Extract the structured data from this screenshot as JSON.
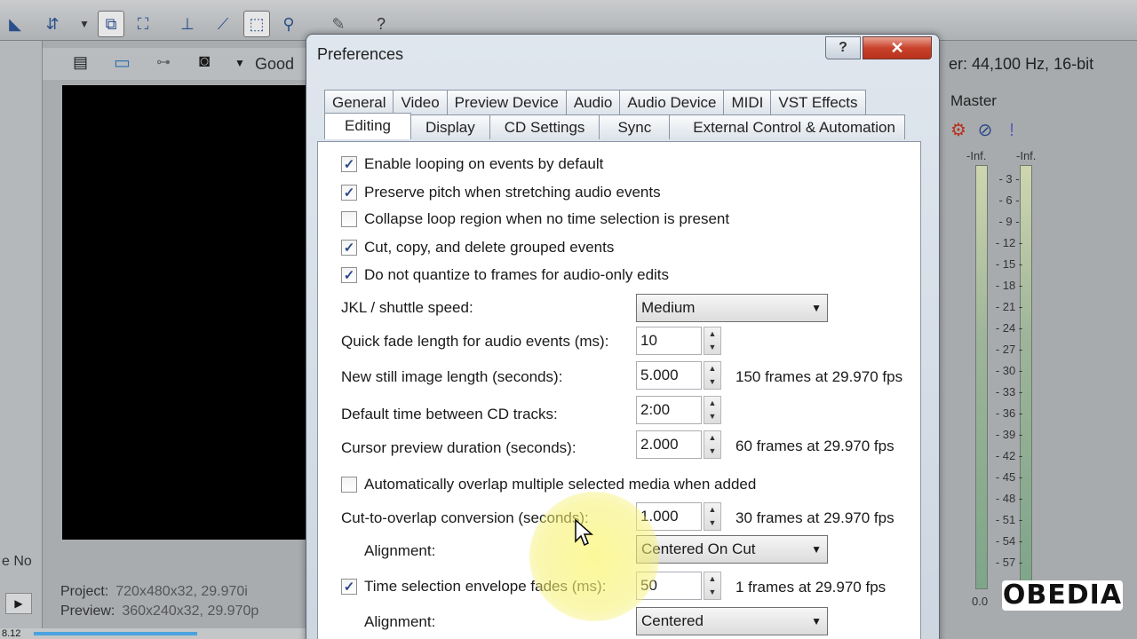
{
  "app": {
    "good_label": "Good",
    "project_label": "Project:",
    "project_value": "720x480x32, 29.970i",
    "preview_label": "Preview:",
    "preview_value": "360x240x32, 29.970p",
    "no_label": "e No",
    "status_left": "8.12",
    "audio_props": "er: 44,100 Hz, 16-bit",
    "master": "Master",
    "inf_left": "-Inf.",
    "inf_right": "-Inf.",
    "meter_scale": [
      "3",
      "6",
      "9",
      "12",
      "15",
      "18",
      "21",
      "24",
      "27",
      "30",
      "33",
      "36",
      "39",
      "42",
      "45",
      "48",
      "51",
      "54",
      "57"
    ],
    "zero_label": "0.0",
    "logo": "OBEDIA"
  },
  "dialog": {
    "title": "Preferences",
    "help": "?",
    "close": "✕",
    "tabs_row1": [
      "General",
      "Video",
      "Preview Device",
      "Audio",
      "Audio Device",
      "MIDI",
      "VST Effects"
    ],
    "tabs_row2": [
      "Editing",
      "Display",
      "CD Settings",
      "Sync",
      "External Control & Automation"
    ],
    "active_tab": "Editing",
    "checkboxes": [
      {
        "label": "Enable looping on events by default",
        "checked": true
      },
      {
        "label": "Preserve pitch when stretching audio events",
        "checked": true
      },
      {
        "label": "Collapse loop region when no time selection is present",
        "checked": false
      },
      {
        "label": "Cut, copy, and delete grouped events",
        "checked": true
      },
      {
        "label": "Do not quantize to frames for audio-only edits",
        "checked": true
      }
    ],
    "jkl_label": "JKL / shuttle speed:",
    "jkl_value": "Medium",
    "quick_fade_label": "Quick fade length for audio events (ms):",
    "quick_fade_value": "10",
    "still_label": "New still image length (seconds):",
    "still_value": "5.000",
    "still_info": "150 frames at 29.970 fps",
    "cd_label": "Default time between CD tracks:",
    "cd_value": "2:00",
    "cursor_label": "Cursor preview duration (seconds):",
    "cursor_value": "2.000",
    "cursor_info": "60 frames at 29.970 fps",
    "auto_overlap": {
      "label": "Automatically overlap multiple selected media when added",
      "checked": false
    },
    "cut_overlap_label": "Cut-to-overlap conversion (seconds):",
    "cut_overlap_value": "1.000",
    "cut_overlap_info": "30 frames at 29.970 fps",
    "alignment_label": "Alignment:",
    "alignment_value": "Centered On Cut",
    "time_sel": {
      "label": "Time selection envelope fades (ms):",
      "checked": true
    },
    "time_sel_value": "50",
    "time_sel_info": "1 frames at 29.970 fps",
    "alignment2_label": "Alignment:",
    "alignment2_value": "Centered"
  },
  "colors": {
    "accent": "#2b4a8a",
    "close_button": "#c9432c",
    "highlight": "#f6f06e"
  }
}
